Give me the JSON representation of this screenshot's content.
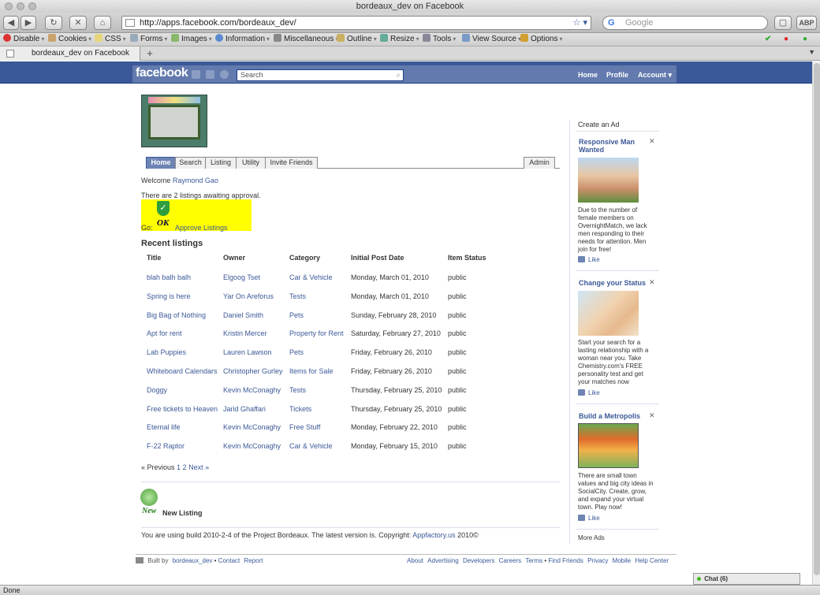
{
  "window": {
    "title": "bordeaux_dev on Facebook"
  },
  "browser": {
    "url": "http://apps.facebook.com/bordeaux_dev/",
    "search_placeholder": "Google",
    "tab_title": "bordeaux_dev on Facebook",
    "new_tab": "+",
    "toolbar": [
      "Disable",
      "Cookies",
      "CSS",
      "Forms",
      "Images",
      "Information",
      "Miscellaneous",
      "Outline",
      "Resize",
      "Tools",
      "View Source",
      "Options"
    ],
    "status": "Done",
    "abp": "ABP"
  },
  "fb": {
    "logo": "facebook",
    "search_placeholder": "Search",
    "nav": {
      "home": "Home",
      "profile": "Profile",
      "account": "Account"
    }
  },
  "app": {
    "tabs": [
      "Home",
      "Search",
      "Listing",
      "Utility",
      "Invite Friends"
    ],
    "admin_tab": "Admin",
    "welcome_prefix": "Welcome",
    "welcome_user": "Raymond Gao",
    "awaiting": "There are 2 listings awaiting approval.",
    "go_label": "Go:",
    "ok_label": "OK",
    "approve_link": "Approve Listings",
    "recent_title": "Recent listings",
    "columns": [
      "Title",
      "Owner",
      "Category",
      "Initial Post Date",
      "Item Status"
    ],
    "rows": [
      [
        "blah balh balh",
        "Elgoog Tset",
        "Car & Vehicle",
        "Monday, March 01, 2010",
        "public"
      ],
      [
        "Spring is here",
        "Yar On Areforus",
        "Tests",
        "Monday, March 01, 2010",
        "public"
      ],
      [
        "Big Bag of Nothing",
        "Daniel Smith",
        "Pets",
        "Sunday, February 28, 2010",
        "public"
      ],
      [
        "Apt for rent",
        "Kristin Mercer",
        "Property for Rent",
        "Saturday, February 27, 2010",
        "public"
      ],
      [
        "Lab Puppies",
        "Lauren Lawson",
        "Pets",
        "Friday, February 26, 2010",
        "public"
      ],
      [
        "Whiteboard Calendars",
        "Christopher Gurley",
        "Items for Sale",
        "Friday, February 26, 2010",
        "public"
      ],
      [
        "Doggy",
        "Kevin McConaghy",
        "Tests",
        "Thursday, February 25, 2010",
        "public"
      ],
      [
        "Free tickets to Heaven",
        "Jarid Ghaffari",
        "Tickets",
        "Thursday, February 25, 2010",
        "public"
      ],
      [
        "Eternal life",
        "Kevin McConaghy",
        "Free Stuff",
        "Monday, February 22, 2010",
        "public"
      ],
      [
        "F-22 Raptor",
        "Kevin McConaghy",
        "Car & Vehicle",
        "Monday, February 15, 2010",
        "public"
      ]
    ],
    "pager": {
      "prev": "« Previous",
      "p1": "1",
      "p2": "2",
      "next": "Next »"
    },
    "new_label": "New",
    "new_listing": "New Listing",
    "build_text": "You are using build 2010-2-4 of the Project Bordeaux. The latest version is. Copyright:",
    "build_link": "Appfactory.us",
    "build_year": "2010©"
  },
  "ads": {
    "create": "Create an Ad",
    "more": "More Ads",
    "like": "Like",
    "items": [
      {
        "title": "Responsive Man Wanted",
        "body": "Due to the number of female members on OvernightMatch, we lack men responding to their needs for attention. Men join for free!"
      },
      {
        "title": "Change your Status",
        "body": "Start your search for a lasting relationship with a woman near you. Take Chemistry.com's FREE personality test and get your matches now"
      },
      {
        "title": "Build a Metropolis",
        "body": "There are small town values and big city ideas in SocialCity. Create, grow, and expand your virtual town. Play now!"
      }
    ]
  },
  "footer": {
    "built_by": "Built by",
    "author": "bordeaux_dev",
    "contact": "Contact",
    "report": "Report",
    "links": [
      "About",
      "Advertising",
      "Developers",
      "Careers",
      "Terms",
      "Find Friends",
      "Privacy",
      "Mobile",
      "Help Center"
    ]
  },
  "chat": {
    "label": "Chat (6)"
  }
}
